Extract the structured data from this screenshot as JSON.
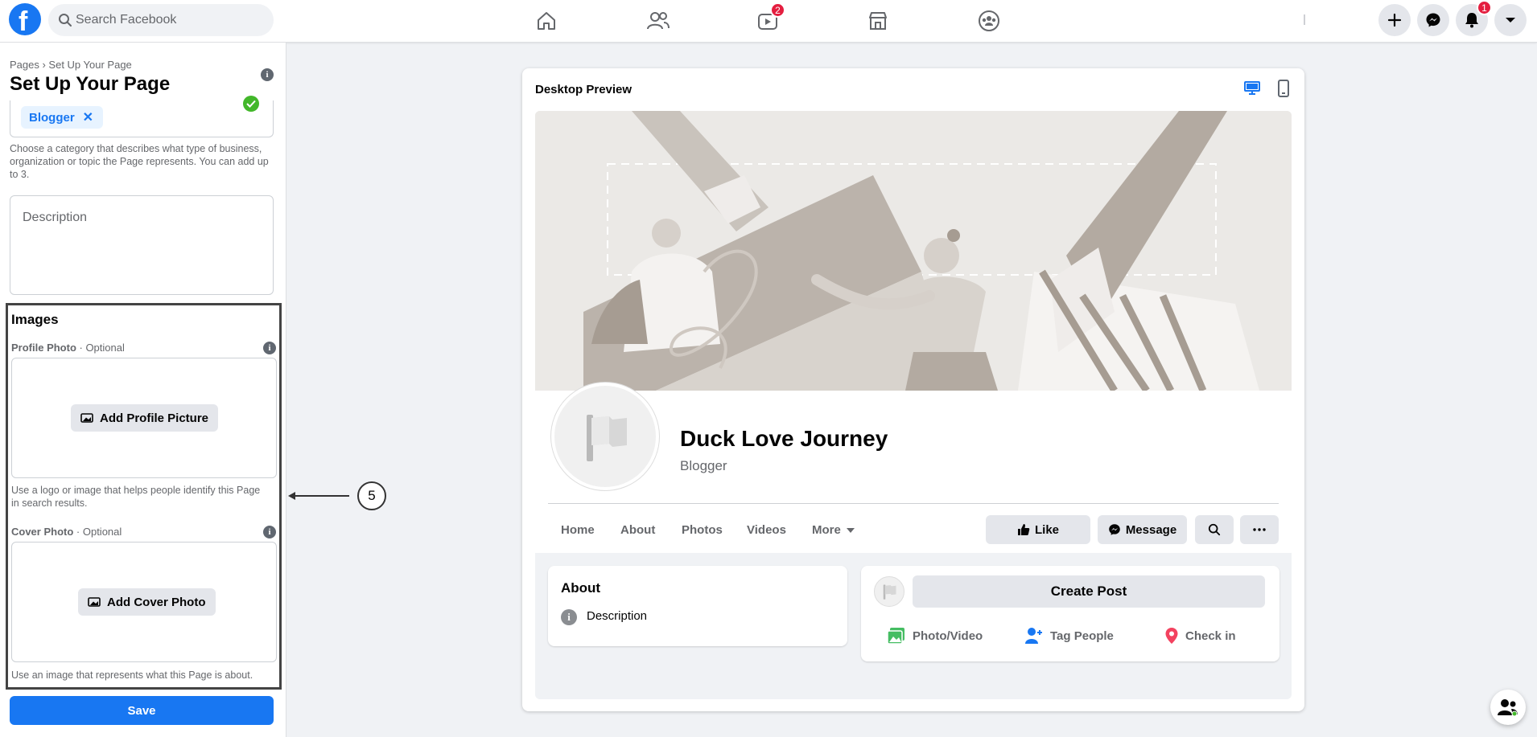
{
  "topbar": {
    "logo_letter": "f",
    "search_placeholder": "Search Facebook",
    "watch_badge": "2",
    "notifications_badge": "1"
  },
  "left_panel": {
    "breadcrumb": "Pages › Set Up Your Page",
    "title": "Set Up Your Page",
    "category_chip": "Blogger",
    "category_help": "Choose a category that describes what type of business, organization or topic the Page represents. You can add up to 3.",
    "description_placeholder": "Description",
    "images_heading": "Images",
    "profile_photo_label": "Profile Photo",
    "profile_photo_optional": " · Optional",
    "add_profile_picture": "Add Profile Picture",
    "profile_help": "Use a logo or image that helps people identify this Page in search results.",
    "cover_photo_label": "Cover Photo",
    "cover_photo_optional": " · Optional",
    "add_cover_photo": "Add Cover Photo",
    "cover_help": "Use an image that represents what this Page is about.",
    "save": "Save"
  },
  "annotation": {
    "step": "5"
  },
  "preview": {
    "title": "Desktop Preview",
    "page_name": "Duck Love Journey",
    "page_category": "Blogger",
    "tabs": [
      "Home",
      "About",
      "Photos",
      "Videos",
      "More"
    ],
    "like": "Like",
    "message": "Message",
    "about_title": "About",
    "about_description": "Description",
    "create_post": "Create Post",
    "photo_video": "Photo/Video",
    "tag_people": "Tag People",
    "check_in": "Check in"
  },
  "colors": {
    "brand": "#1877f2",
    "badge": "#e41e3f",
    "success": "#42b72a"
  }
}
